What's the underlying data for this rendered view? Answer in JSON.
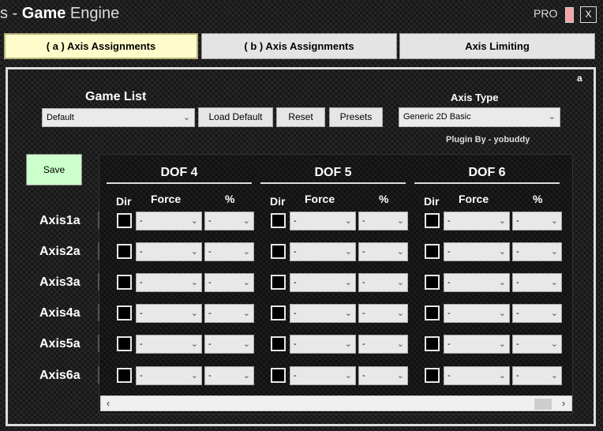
{
  "window": {
    "title_prefix": "s - ",
    "title_bold": "Game",
    "title_suffix": " Engine",
    "pro_label": "PRO",
    "close_label": "X"
  },
  "tabs": [
    {
      "label": "( a ) Axis Assignments",
      "active": true
    },
    {
      "label": "( b ) Axis Assignments",
      "active": false
    },
    {
      "label": "Axis Limiting",
      "active": false
    }
  ],
  "panel": {
    "corner_label": "a",
    "game_list_label": "Game List",
    "game_list_value": "Default",
    "load_default_label": "Load Default",
    "reset_label": "Reset",
    "presets_label": "Presets",
    "axis_type_label": "Axis Type",
    "axis_type_value": "Generic 2D Basic",
    "plugin_by": "Plugin By - yobuddy",
    "save_label": "Save"
  },
  "grid": {
    "column_headers": {
      "dir": "Dir",
      "force": "Force",
      "percent": "%"
    },
    "dofs": [
      "DOF 4",
      "DOF 5",
      "DOF 6"
    ],
    "axes": [
      "Axis1a",
      "Axis2a",
      "Axis3a",
      "Axis4a",
      "Axis5a",
      "Axis6a"
    ],
    "cell_force_value": "-",
    "cell_percent_value": "-"
  },
  "colors": {
    "active_tab": "#fffccc",
    "save_button": "#ccffcc",
    "pro_indicator": "#f4a4a4"
  },
  "icons": {
    "dropdown": "chevron-down-icon",
    "scroll_left": "chevron-left-icon",
    "scroll_right": "chevron-right-icon",
    "close": "close-icon"
  }
}
